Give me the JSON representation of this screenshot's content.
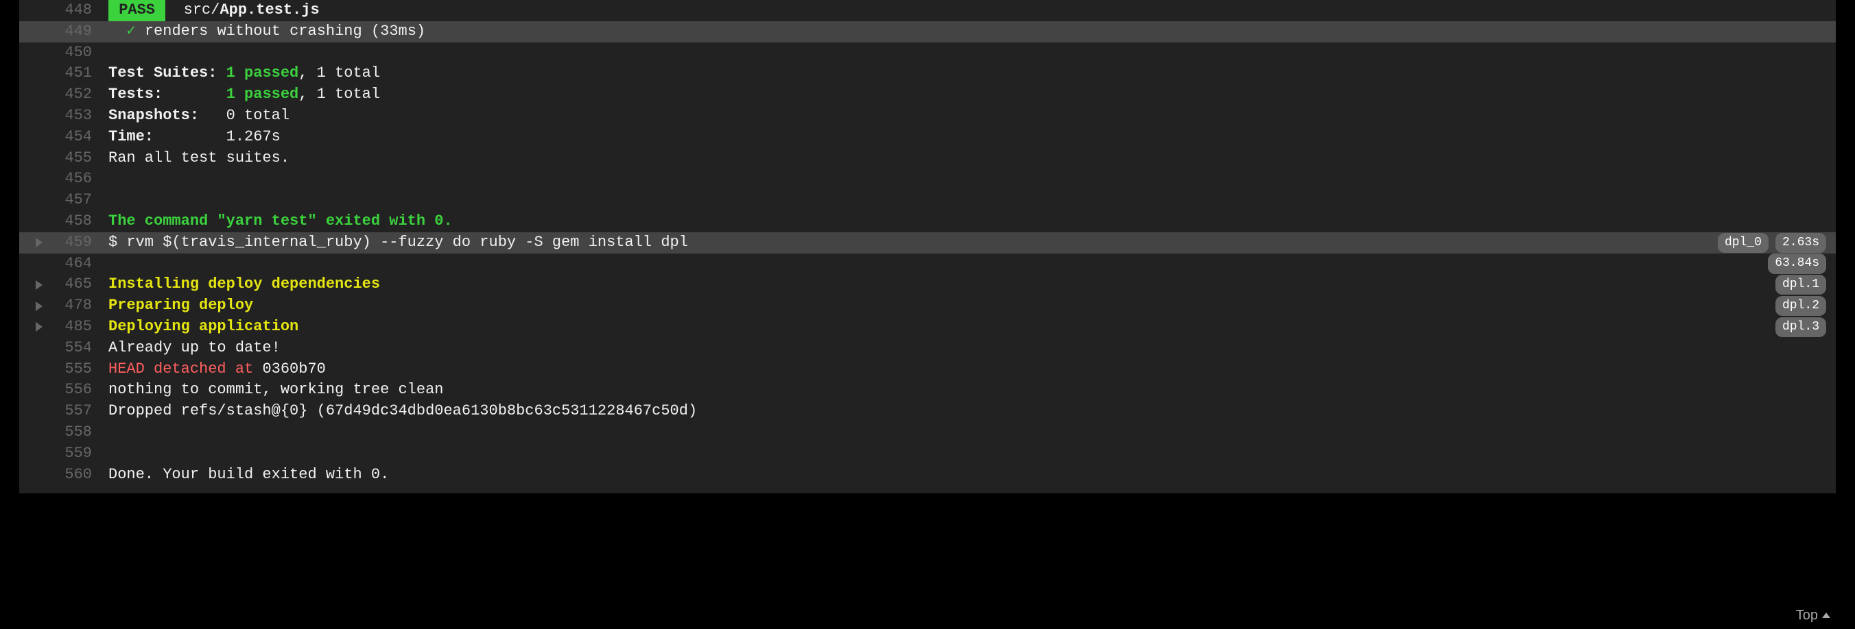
{
  "lines": [
    {
      "no": "448",
      "hl": false,
      "arrow": false,
      "segs": [
        {
          "cls": "pass-badge",
          "t": " PASS "
        },
        {
          "cls": "c-white",
          "t": "  src/"
        },
        {
          "cls": "c-bwhite",
          "t": "App.test.js"
        }
      ]
    },
    {
      "no": "449",
      "hl": true,
      "arrow": false,
      "segs": [
        {
          "cls": "c-green",
          "t": "  ✓ "
        },
        {
          "cls": "c-white",
          "t": "renders without crashing (33ms)"
        }
      ]
    },
    {
      "no": "450",
      "hl": false,
      "arrow": false,
      "segs": [
        {
          "cls": "c-white",
          "t": " "
        }
      ]
    },
    {
      "no": "451",
      "hl": false,
      "arrow": false,
      "segs": [
        {
          "cls": "c-bwhite",
          "t": "Test Suites: "
        },
        {
          "cls": "c-bgreen",
          "t": "1 passed"
        },
        {
          "cls": "c-white",
          "t": ", 1 total"
        }
      ]
    },
    {
      "no": "452",
      "hl": false,
      "arrow": false,
      "segs": [
        {
          "cls": "c-bwhite",
          "t": "Tests:       "
        },
        {
          "cls": "c-bgreen",
          "t": "1 passed"
        },
        {
          "cls": "c-white",
          "t": ", 1 total"
        }
      ]
    },
    {
      "no": "453",
      "hl": false,
      "arrow": false,
      "segs": [
        {
          "cls": "c-bwhite",
          "t": "Snapshots:   "
        },
        {
          "cls": "c-white",
          "t": "0 total"
        }
      ]
    },
    {
      "no": "454",
      "hl": false,
      "arrow": false,
      "segs": [
        {
          "cls": "c-bwhite",
          "t": "Time:"
        },
        {
          "cls": "c-white",
          "t": "        1.267s"
        }
      ]
    },
    {
      "no": "455",
      "hl": false,
      "arrow": false,
      "segs": [
        {
          "cls": "c-white",
          "t": "Ran all test suites."
        }
      ]
    },
    {
      "no": "456",
      "hl": false,
      "arrow": false,
      "segs": [
        {
          "cls": "c-white",
          "t": " "
        }
      ]
    },
    {
      "no": "457",
      "hl": false,
      "arrow": false,
      "segs": [
        {
          "cls": "c-white",
          "t": " "
        }
      ]
    },
    {
      "no": "458",
      "hl": false,
      "arrow": false,
      "segs": [
        {
          "cls": "c-bgreen",
          "t": "The command \"yarn test\" exited with 0."
        }
      ]
    },
    {
      "no": "459",
      "hl": true,
      "arrow": true,
      "segs": [
        {
          "cls": "c-white",
          "t": "$ rvm $(travis_internal_ruby) --fuzzy do ruby -S gem install dpl"
        }
      ],
      "badges": [
        "dpl_0",
        "2.63s"
      ]
    },
    {
      "no": "464",
      "hl": false,
      "arrow": false,
      "segs": [
        {
          "cls": "c-white",
          "t": " "
        }
      ],
      "badges": [
        "63.84s"
      ]
    },
    {
      "no": "465",
      "hl": false,
      "arrow": true,
      "segs": [
        {
          "cls": "c-byellow",
          "t": "Installing deploy dependencies"
        }
      ],
      "badges": [
        "dpl.1"
      ]
    },
    {
      "no": "478",
      "hl": false,
      "arrow": true,
      "segs": [
        {
          "cls": "c-byellow",
          "t": "Preparing deploy"
        }
      ],
      "badges": [
        "dpl.2"
      ]
    },
    {
      "no": "485",
      "hl": false,
      "arrow": true,
      "segs": [
        {
          "cls": "c-byellow",
          "t": "Deploying application"
        }
      ],
      "badges": [
        "dpl.3"
      ]
    },
    {
      "no": "554",
      "hl": false,
      "arrow": false,
      "segs": [
        {
          "cls": "c-white",
          "t": "Already up to date!"
        }
      ]
    },
    {
      "no": "555",
      "hl": false,
      "arrow": false,
      "segs": [
        {
          "cls": "c-red",
          "t": "HEAD detached at "
        },
        {
          "cls": "c-white",
          "t": "0360b70"
        }
      ]
    },
    {
      "no": "556",
      "hl": false,
      "arrow": false,
      "segs": [
        {
          "cls": "c-white",
          "t": "nothing to commit, working tree clean"
        }
      ]
    },
    {
      "no": "557",
      "hl": false,
      "arrow": false,
      "segs": [
        {
          "cls": "c-white",
          "t": "Dropped refs/stash@{0} (67d49dc34dbd0ea6130b8bc63c5311228467c50d)"
        }
      ]
    },
    {
      "no": "558",
      "hl": false,
      "arrow": false,
      "segs": [
        {
          "cls": "c-white",
          "t": " "
        }
      ]
    },
    {
      "no": "559",
      "hl": false,
      "arrow": false,
      "segs": [
        {
          "cls": "c-white",
          "t": " "
        }
      ]
    },
    {
      "no": "560",
      "hl": false,
      "arrow": false,
      "segs": [
        {
          "cls": "c-white",
          "t": "Done. Your build exited with 0."
        }
      ]
    }
  ],
  "top_link": {
    "label": "Top"
  }
}
